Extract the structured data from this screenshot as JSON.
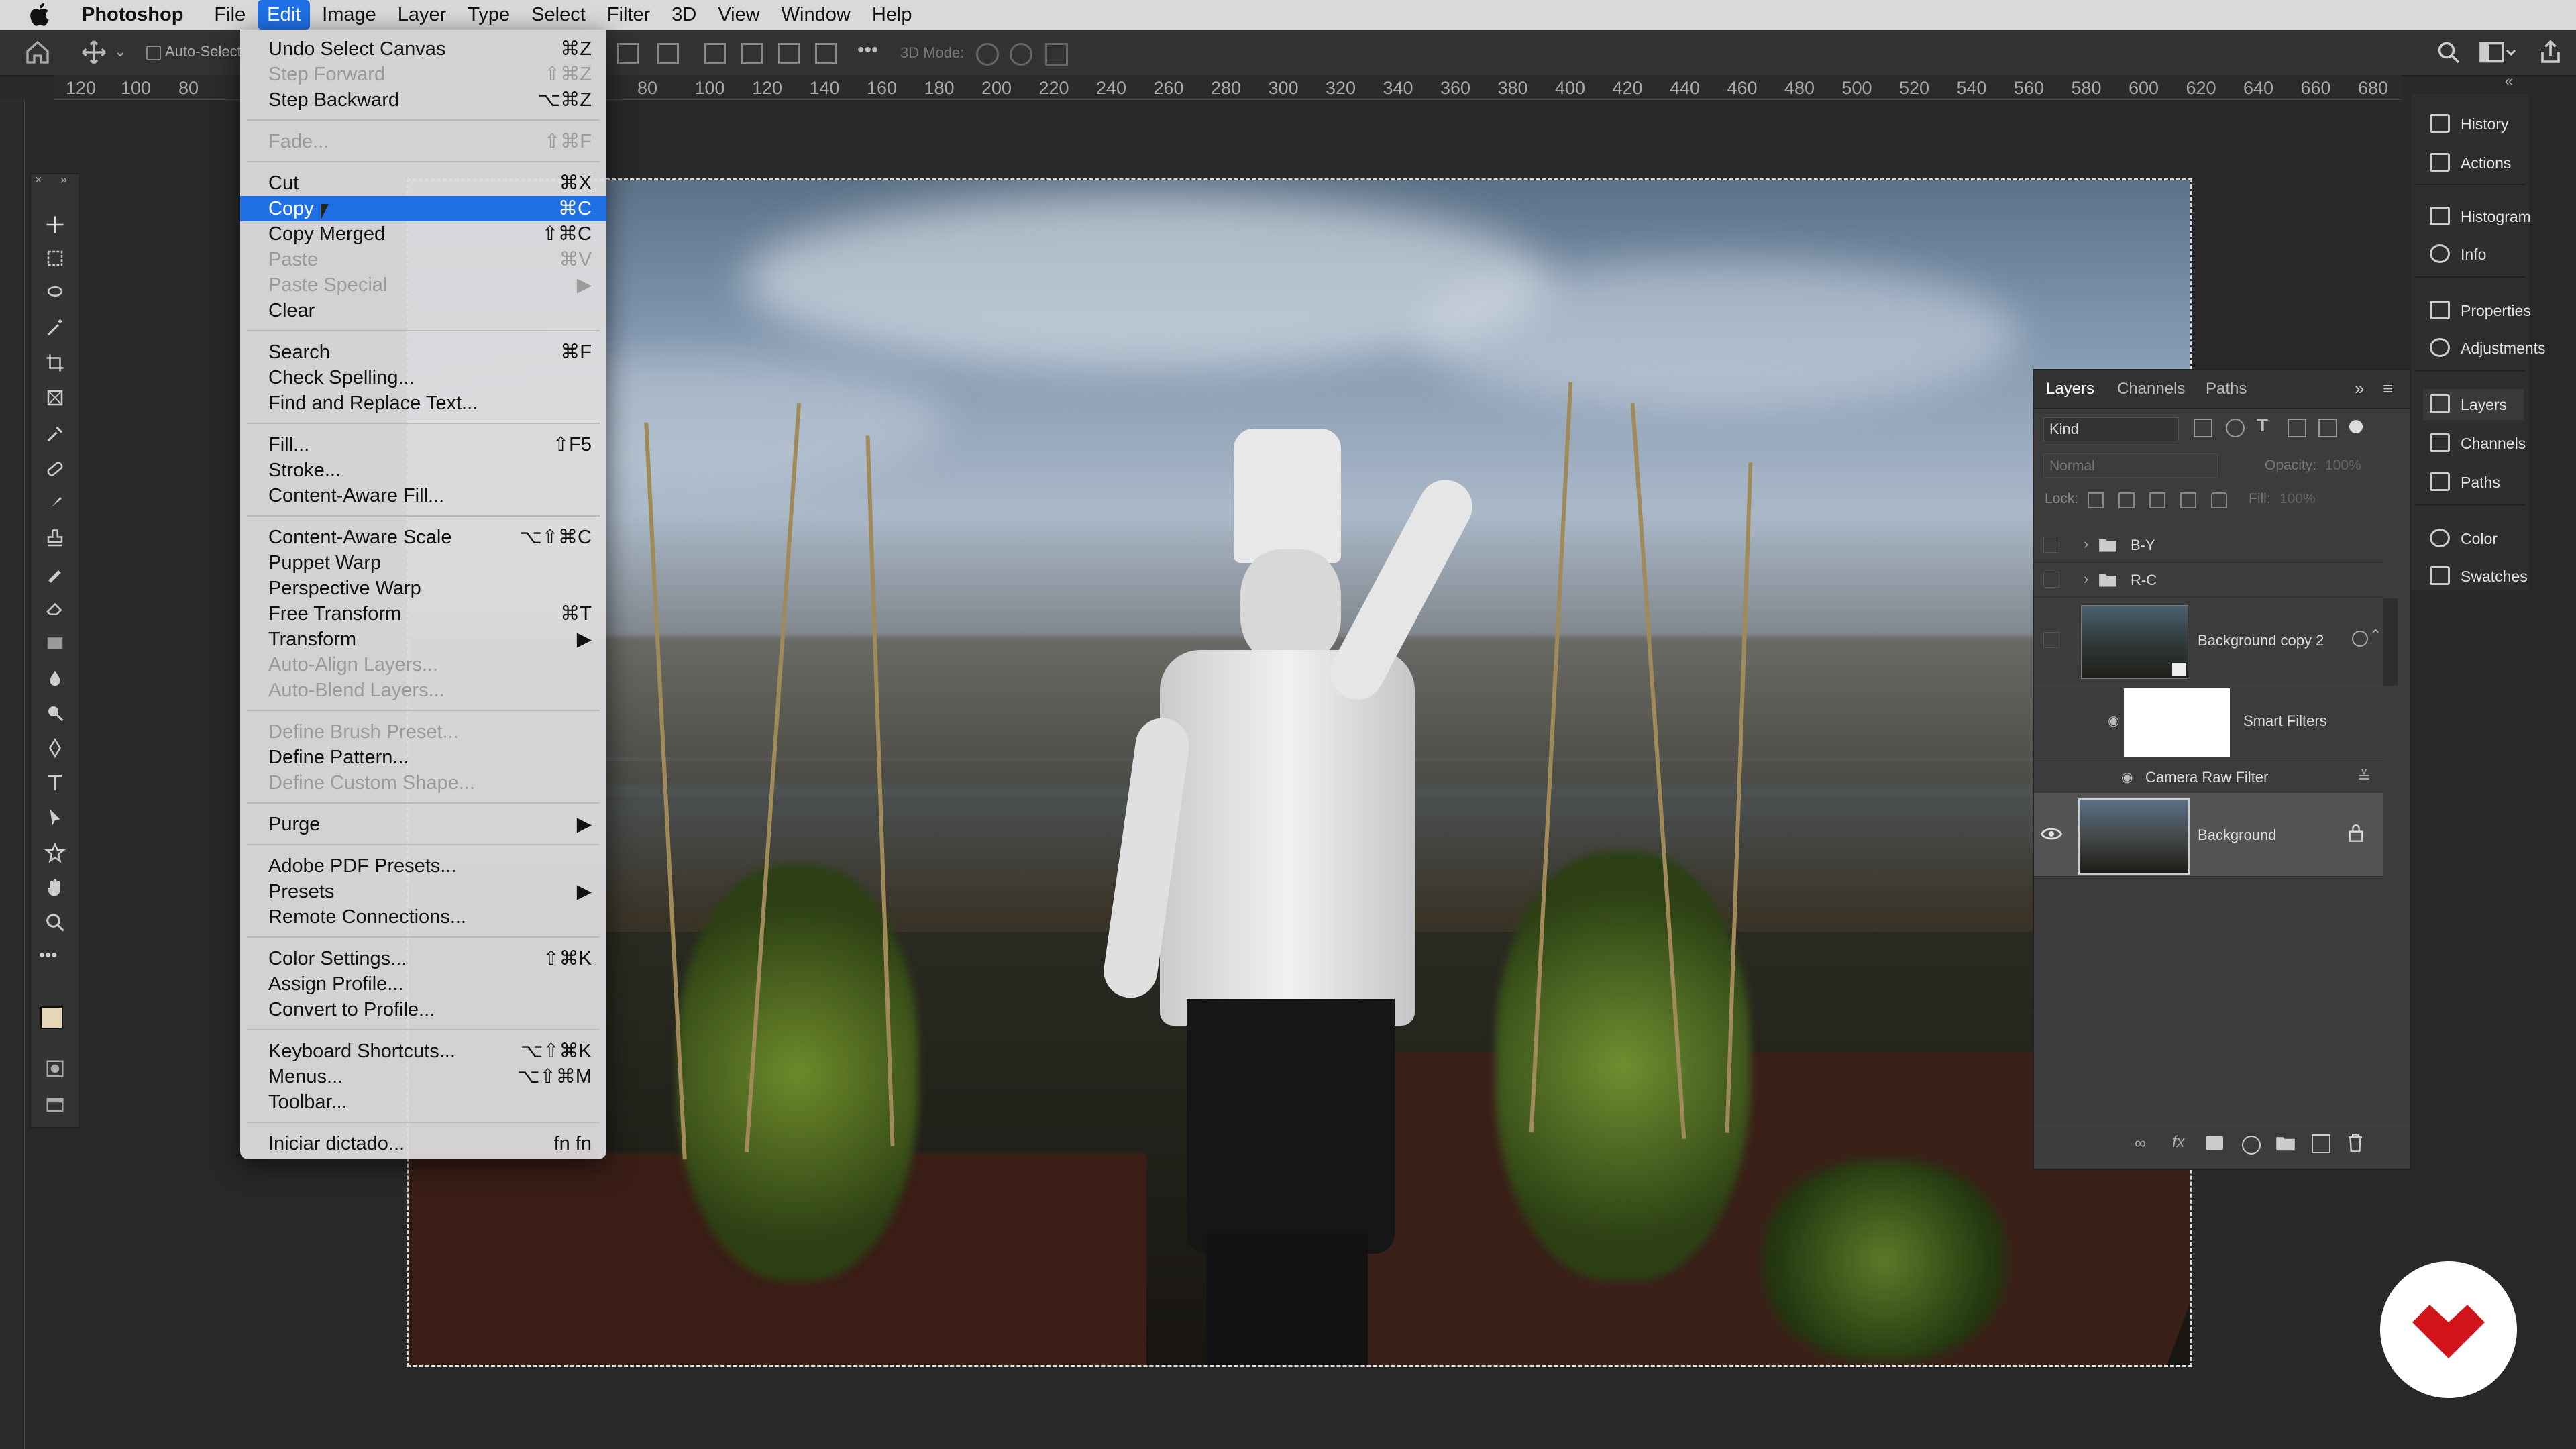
{
  "menubar": {
    "app": "Photoshop",
    "items": [
      "File",
      "Edit",
      "Image",
      "Layer",
      "Type",
      "Select",
      "Filter",
      "3D",
      "View",
      "Window",
      "Help"
    ],
    "active": "Edit"
  },
  "options_bar": {
    "auto_select_label": "Auto-Select",
    "mode_label": "3D Mode:"
  },
  "ruler": {
    "left_ticks": [
      "120",
      "100",
      "80"
    ],
    "ticks": [
      "80",
      "100",
      "120",
      "140",
      "160",
      "180",
      "200",
      "220",
      "240",
      "260",
      "280",
      "300",
      "320",
      "340",
      "360",
      "380",
      "400",
      "420",
      "440",
      "460",
      "480",
      "500",
      "520",
      "540",
      "560",
      "580",
      "600",
      "620",
      "640",
      "660",
      "680"
    ]
  },
  "edit_menu": {
    "items": [
      {
        "label": "Undo Select Canvas",
        "shortcut": "⌘Z",
        "disabled": false
      },
      {
        "label": "Step Forward",
        "shortcut": "⇧⌘Z",
        "disabled": true
      },
      {
        "label": "Step Backward",
        "shortcut": "⌥⌘Z",
        "disabled": false
      },
      {
        "sep": true
      },
      {
        "label": "Fade...",
        "shortcut": "⇧⌘F",
        "disabled": true
      },
      {
        "sep": true
      },
      {
        "label": "Cut",
        "shortcut": "⌘X",
        "disabled": false
      },
      {
        "label": "Copy",
        "shortcut": "⌘C",
        "disabled": false,
        "highlighted": true
      },
      {
        "label": "Copy Merged",
        "shortcut": "⇧⌘C",
        "disabled": false
      },
      {
        "label": "Paste",
        "shortcut": "⌘V",
        "disabled": true
      },
      {
        "label": "Paste Special",
        "shortcut": "▶",
        "disabled": true
      },
      {
        "label": "Clear",
        "shortcut": "",
        "disabled": false
      },
      {
        "sep": true
      },
      {
        "label": "Search",
        "shortcut": "⌘F",
        "disabled": false
      },
      {
        "label": "Check Spelling...",
        "shortcut": "",
        "disabled": false
      },
      {
        "label": "Find and Replace Text...",
        "shortcut": "",
        "disabled": false
      },
      {
        "sep": true
      },
      {
        "label": "Fill...",
        "shortcut": "⇧F5",
        "disabled": false
      },
      {
        "label": "Stroke...",
        "shortcut": "",
        "disabled": false
      },
      {
        "label": "Content-Aware Fill...",
        "shortcut": "",
        "disabled": false
      },
      {
        "sep": true
      },
      {
        "label": "Content-Aware Scale",
        "shortcut": "⌥⇧⌘C",
        "disabled": false
      },
      {
        "label": "Puppet Warp",
        "shortcut": "",
        "disabled": false
      },
      {
        "label": "Perspective Warp",
        "shortcut": "",
        "disabled": false
      },
      {
        "label": "Free Transform",
        "shortcut": "⌘T",
        "disabled": false
      },
      {
        "label": "Transform",
        "shortcut": "▶",
        "disabled": false
      },
      {
        "label": "Auto-Align Layers...",
        "shortcut": "",
        "disabled": true
      },
      {
        "label": "Auto-Blend Layers...",
        "shortcut": "",
        "disabled": true
      },
      {
        "sep": true
      },
      {
        "label": "Define Brush Preset...",
        "shortcut": "",
        "disabled": true
      },
      {
        "label": "Define Pattern...",
        "shortcut": "",
        "disabled": false
      },
      {
        "label": "Define Custom Shape...",
        "shortcut": "",
        "disabled": true
      },
      {
        "sep": true
      },
      {
        "label": "Purge",
        "shortcut": "▶",
        "disabled": false
      },
      {
        "sep": true
      },
      {
        "label": "Adobe PDF Presets...",
        "shortcut": "",
        "disabled": false
      },
      {
        "label": "Presets",
        "shortcut": "▶",
        "disabled": false
      },
      {
        "label": "Remote Connections...",
        "shortcut": "",
        "disabled": false
      },
      {
        "sep": true
      },
      {
        "label": "Color Settings...",
        "shortcut": "⇧⌘K",
        "disabled": false
      },
      {
        "label": "Assign Profile...",
        "shortcut": "",
        "disabled": false
      },
      {
        "label": "Convert to Profile...",
        "shortcut": "",
        "disabled": false
      },
      {
        "sep": true
      },
      {
        "label": "Keyboard Shortcuts...",
        "shortcut": "⌥⇧⌘K",
        "disabled": false
      },
      {
        "label": "Menus...",
        "shortcut": "⌥⇧⌘M",
        "disabled": false
      },
      {
        "label": "Toolbar...",
        "shortcut": "",
        "disabled": false
      },
      {
        "sep": true
      },
      {
        "label": "Iniciar dictado...",
        "shortcut": "fn fn",
        "disabled": false
      }
    ]
  },
  "layers_panel": {
    "tabs": [
      "Layers",
      "Channels",
      "Paths"
    ],
    "active_tab": "Layers",
    "filter_label": "Kind",
    "blend_mode": "Normal",
    "opacity_label": "Opacity:",
    "opacity_value": "100%",
    "lock_label": "Lock:",
    "fill_label": "Fill:",
    "fill_value": "100%",
    "layers": [
      {
        "name": "B-Y",
        "type": "group"
      },
      {
        "name": "R-C",
        "type": "group"
      },
      {
        "name": "Background copy 2",
        "type": "smart"
      },
      {
        "name": "Smart Filters",
        "type": "filter-mask"
      },
      {
        "name": "Camera Raw Filter",
        "type": "filter"
      },
      {
        "name": "Background",
        "type": "background",
        "visible": true,
        "locked": true
      }
    ]
  },
  "dock": {
    "items": [
      {
        "label": "History",
        "icon": "history-icon"
      },
      {
        "label": "Actions",
        "icon": "play-icon"
      },
      {
        "label": "Histogram",
        "icon": "histogram-icon"
      },
      {
        "label": "Info",
        "icon": "info-icon"
      },
      {
        "label": "Properties",
        "icon": "properties-icon"
      },
      {
        "label": "Adjustments",
        "icon": "adjustments-icon"
      },
      {
        "label": "Layers",
        "icon": "layers-icon"
      },
      {
        "label": "Channels",
        "icon": "channels-icon"
      },
      {
        "label": "Paths",
        "icon": "paths-icon"
      },
      {
        "label": "Color",
        "icon": "color-icon"
      },
      {
        "label": "Swatches",
        "icon": "swatches-icon"
      }
    ],
    "active": "Layers"
  },
  "colors": {
    "menu_highlight": "#1f6fe5",
    "brand_logo": "#d0141a"
  }
}
